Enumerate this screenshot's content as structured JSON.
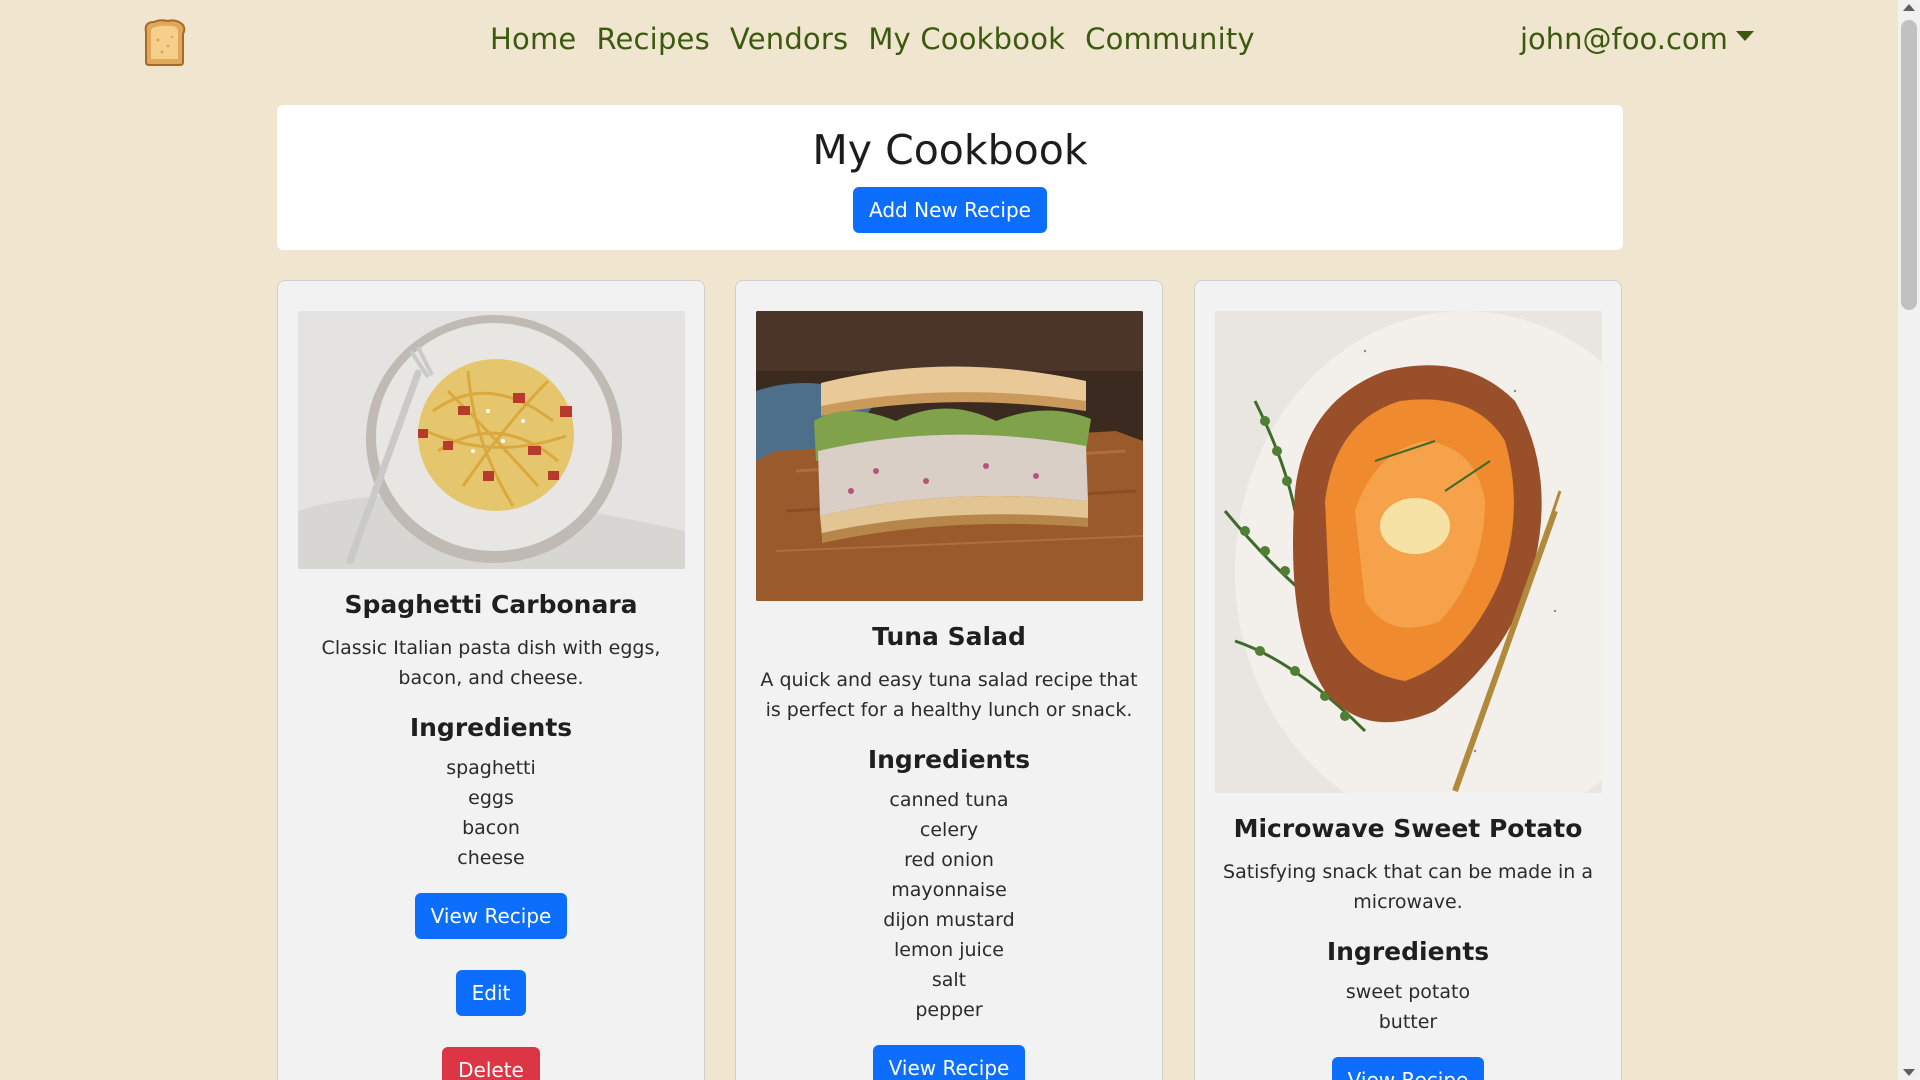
{
  "nav": {
    "links": [
      "Home",
      "Recipes",
      "Vendors",
      "My Cookbook",
      "Community"
    ],
    "user": "john@foo.com"
  },
  "header": {
    "title": "My Cookbook",
    "add_button": "Add New Recipe"
  },
  "recipes": [
    {
      "title": "Spaghetti Carbonara",
      "description": "Classic Italian pasta dish with eggs, bacon, and cheese.",
      "ingredients_heading": "Ingredients",
      "ingredients": [
        "spaghetti",
        "eggs",
        "bacon",
        "cheese"
      ],
      "view_label": "View Recipe",
      "edit_label": "Edit",
      "delete_label": "Delete"
    },
    {
      "title": "Tuna Salad",
      "description": "A quick and easy tuna salad recipe that is perfect for a healthy lunch or snack.",
      "ingredients_heading": "Ingredients",
      "ingredients": [
        "canned tuna",
        "celery",
        "red onion",
        "mayonnaise",
        "dijon mustard",
        "lemon juice",
        "salt",
        "pepper"
      ],
      "view_label": "View Recipe"
    },
    {
      "title": "Microwave Sweet Potato",
      "description": "Satisfying snack that can be made in a microwave.",
      "ingredients_heading": "Ingredients",
      "ingredients": [
        "sweet potato",
        "butter"
      ],
      "view_label": "View Recipe"
    }
  ],
  "colors": {
    "background": "#f0e6cf",
    "nav_link": "#3c5a0e",
    "primary": "#0d6efd",
    "danger": "#dc3545"
  },
  "icons": {
    "logo": "toast-icon",
    "user_menu": "caret-down-icon"
  }
}
